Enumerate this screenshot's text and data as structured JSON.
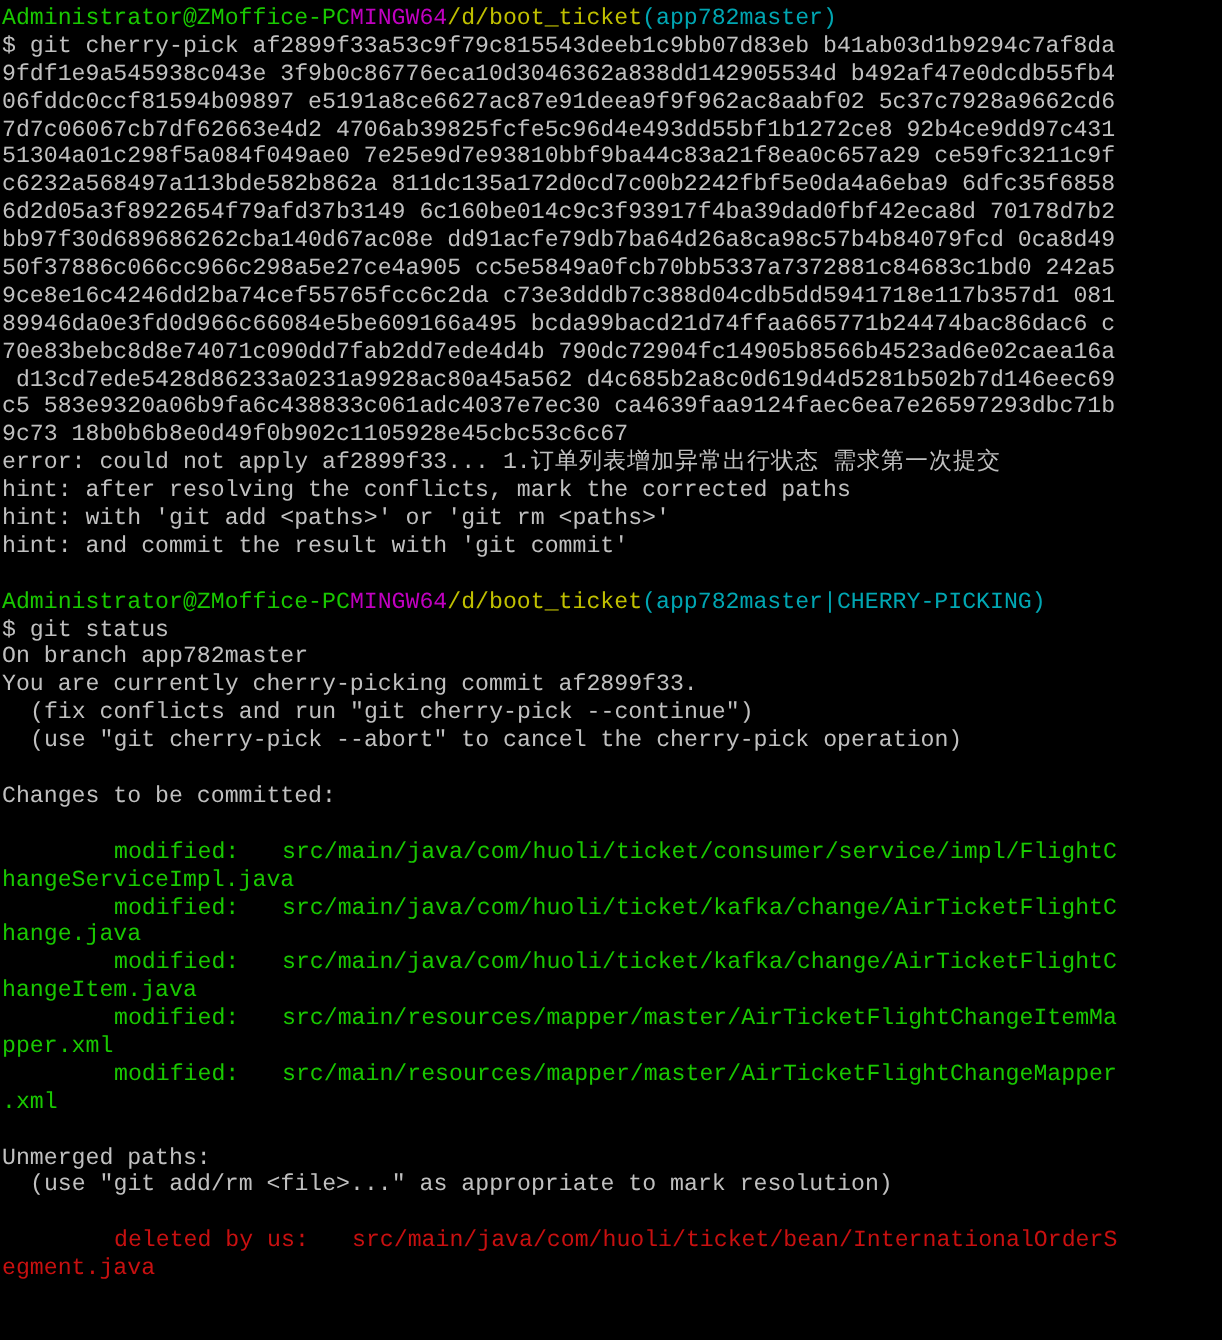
{
  "lines": [
    {
      "kind": "prompt",
      "user": "Administrator@ZMoffice-PC",
      "shell": "MINGW64",
      "path": "/d/boot_ticket",
      "branch": "(app782master)"
    },
    {
      "kind": "command",
      "text": "$ git cherry-pick af2899f33a53c9f79c815543deeb1c9bb07d83eb b41ab03d1b9294c7af8da"
    },
    {
      "kind": "output",
      "text": "9fdf1e9a545938c043e 3f9b0c86776eca10d3046362a838dd142905534d b492af47e0dcdb55fb4"
    },
    {
      "kind": "output",
      "text": "06fddc0ccf81594b09897 e5191a8ce6627ac87e91deea9f9f962ac8aabf02 5c37c7928a9662cd6"
    },
    {
      "kind": "output",
      "text": "7d7c06067cb7df62663e4d2 4706ab39825fcfe5c96d4e493dd55bf1b1272ce8 92b4ce9dd97c431"
    },
    {
      "kind": "output",
      "text": "51304a01c298f5a084f049ae0 7e25e9d7e93810bbf9ba44c83a21f8ea0c657a29 ce59fc3211c9f"
    },
    {
      "kind": "output",
      "text": "c6232a568497a113bde582b862a 811dc135a172d0cd7c00b2242fbf5e0da4a6eba9 6dfc35f6858"
    },
    {
      "kind": "output",
      "text": "6d2d05a3f8922654f79afd37b3149 6c160be014c9c3f93917f4ba39dad0fbf42eca8d 70178d7b2"
    },
    {
      "kind": "output",
      "text": "bb97f30d689686262cba140d67ac08e dd91acfe79db7ba64d26a8ca98c57b4b84079fcd 0ca8d49"
    },
    {
      "kind": "output",
      "text": "50f37886c066cc966c298a5e27ce4a905 cc5e5849a0fcb70bb5337a7372881c84683c1bd0 242a5"
    },
    {
      "kind": "output",
      "text": "9ce8e16c4246dd2ba74cef55765fcc6c2da c73e3dddb7c388d04cdb5dd5941718e117b357d1 081"
    },
    {
      "kind": "output",
      "text": "89946da0e3fd0d966c66084e5be609166a495 bcda99bacd21d74ffaa665771b24474bac86dac6 c"
    },
    {
      "kind": "output",
      "text": "70e83bebc8d8e74071c090dd7fab2dd7ede4d4b 790dc72904fc14905b8566b4523ad6e02caea16a"
    },
    {
      "kind": "output",
      "text": " d13cd7ede5428d86233a0231a9928ac80a45a562 d4c685b2a8c0d619d4d5281b502b7d146eec69"
    },
    {
      "kind": "output",
      "text": "c5 583e9320a06b9fa6c438833c061adc4037e7ec30 ca4639faa9124faec6ea7e26597293dbc71b"
    },
    {
      "kind": "output",
      "text": "9c73 18b0b6b8e0d49f0b902c1105928e45cbc53c6c67"
    },
    {
      "kind": "output",
      "text": "error: could not apply af2899f33... 1.订单列表增加异常出行状态 需求第一次提交"
    },
    {
      "kind": "output",
      "text": "hint: after resolving the conflicts, mark the corrected paths"
    },
    {
      "kind": "output",
      "text": "hint: with 'git add <paths>' or 'git rm <paths>'"
    },
    {
      "kind": "output",
      "text": "hint: and commit the result with 'git commit'"
    },
    {
      "kind": "blank"
    },
    {
      "kind": "prompt",
      "user": "Administrator@ZMoffice-PC",
      "shell": "MINGW64",
      "path": "/d/boot_ticket",
      "branch": "(app782master|CHERRY-PICKING)"
    },
    {
      "kind": "command",
      "text": "$ git status"
    },
    {
      "kind": "output",
      "text": "On branch app782master"
    },
    {
      "kind": "output",
      "text": "You are currently cherry-picking commit af2899f33."
    },
    {
      "kind": "note",
      "text": "(fix conflicts and run \"git cherry-pick --continue\")"
    },
    {
      "kind": "note",
      "text": "(use \"git cherry-pick --abort\" to cancel the cherry-pick operation)"
    },
    {
      "kind": "blank"
    },
    {
      "kind": "output",
      "text": "Changes to be committed:"
    },
    {
      "kind": "blank"
    },
    {
      "kind": "staged",
      "status": "modified:",
      "file": "src/main/java/com/huoli/ticket/consumer/service/impl/FlightC"
    },
    {
      "kind": "staged-wrap",
      "text": "hangeServiceImpl.java"
    },
    {
      "kind": "staged",
      "status": "modified:",
      "file": "src/main/java/com/huoli/ticket/kafka/change/AirTicketFlightC"
    },
    {
      "kind": "staged-wrap",
      "text": "hange.java"
    },
    {
      "kind": "staged",
      "status": "modified:",
      "file": "src/main/java/com/huoli/ticket/kafka/change/AirTicketFlightC"
    },
    {
      "kind": "staged-wrap",
      "text": "hangeItem.java"
    },
    {
      "kind": "staged",
      "status": "modified:",
      "file": "src/main/resources/mapper/master/AirTicketFlightChangeItemMa"
    },
    {
      "kind": "staged-wrap",
      "text": "pper.xml"
    },
    {
      "kind": "staged",
      "status": "modified:",
      "file": "src/main/resources/mapper/master/AirTicketFlightChangeMapper"
    },
    {
      "kind": "staged-wrap",
      "text": ".xml"
    },
    {
      "kind": "blank"
    },
    {
      "kind": "output",
      "text": "Unmerged paths:"
    },
    {
      "kind": "note",
      "text": "(use \"git add/rm <file>...\" as appropriate to mark resolution)"
    },
    {
      "kind": "blank"
    },
    {
      "kind": "unmerged",
      "status": "deleted by us:",
      "file": "src/main/java/com/huoli/ticket/bean/InternationalOrderS"
    },
    {
      "kind": "unmerged-wrap",
      "text": "egment.java"
    }
  ]
}
